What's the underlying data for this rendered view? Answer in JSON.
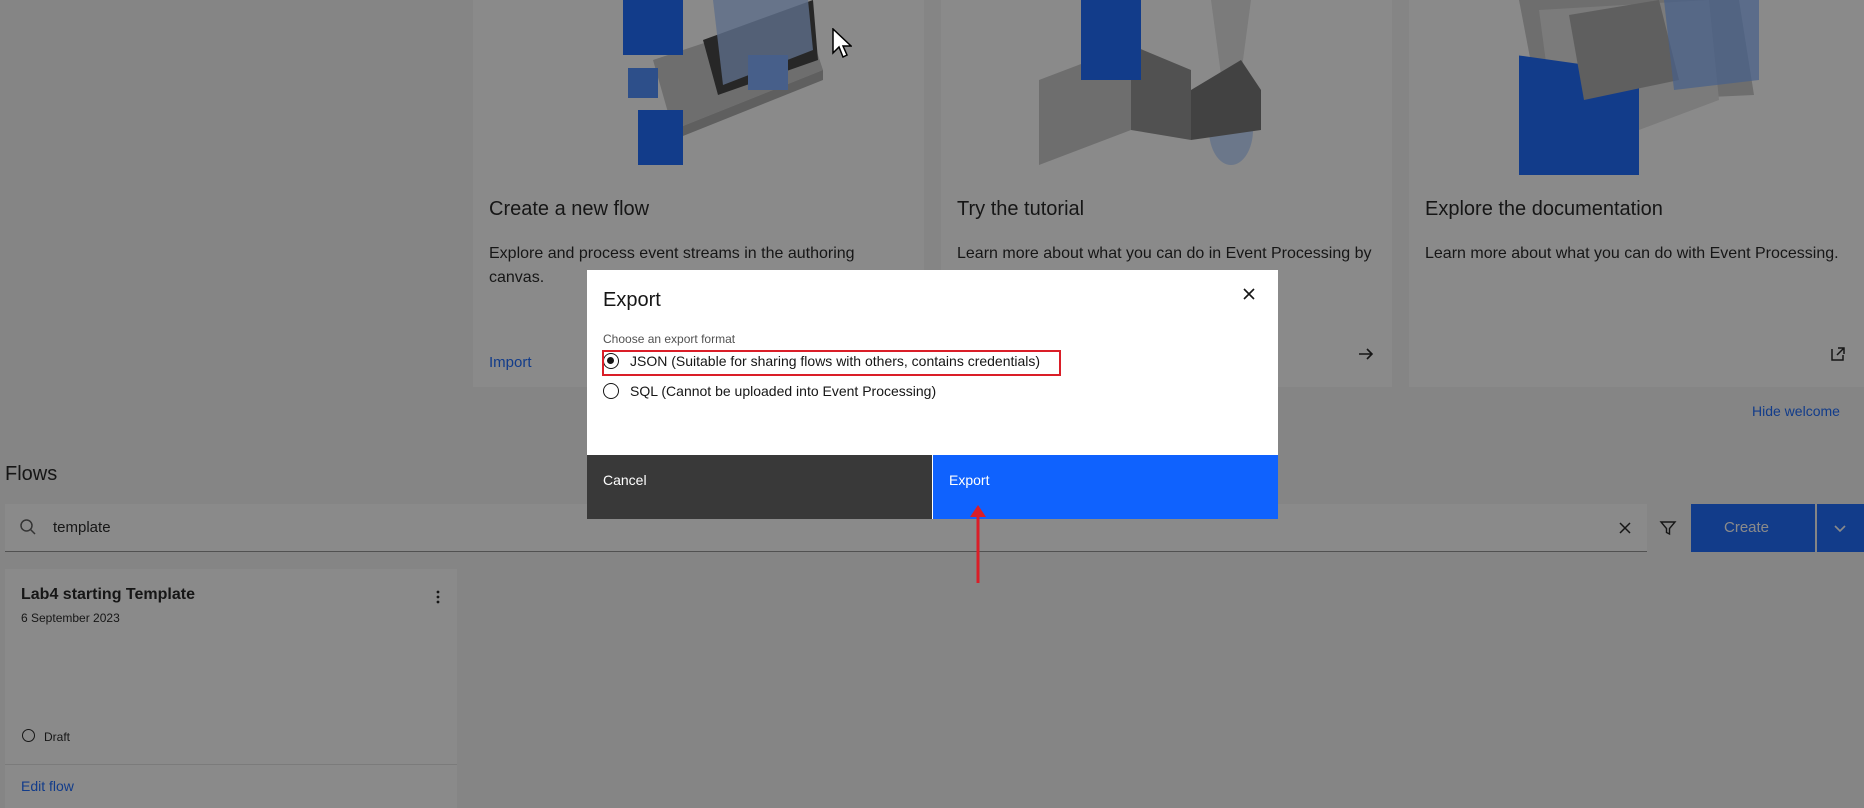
{
  "welcome": {
    "tiles": [
      {
        "title": "Create a new flow",
        "description": "Explore and process event streams in the authoring canvas.",
        "link": "Import"
      },
      {
        "title": "Try the tutorial",
        "description": "Learn more about what you can do in Event Processing by",
        "link": ""
      },
      {
        "title": "Explore the documentation",
        "description": "Learn more about what you can do with Event Processing.",
        "link": ""
      }
    ],
    "hide_label": "Hide welcome"
  },
  "flows": {
    "heading": "Flows",
    "search": {
      "value": "template"
    },
    "create_label": "Create",
    "items": [
      {
        "title": "Lab4 starting Template",
        "date": "6 September 2023",
        "status": "Draft",
        "edit_label": "Edit flow"
      }
    ]
  },
  "modal": {
    "title": "Export",
    "group_label": "Choose an export format",
    "options": [
      {
        "label": "JSON (Suitable for sharing flows with others, contains credentials)",
        "checked": true
      },
      {
        "label": "SQL (Cannot be uploaded into Event Processing)",
        "checked": false
      }
    ],
    "cancel_label": "Cancel",
    "export_label": "Export"
  },
  "colors": {
    "primary": "#0f62fe",
    "secondary_button": "#393939",
    "annotation": "#da1e28"
  }
}
